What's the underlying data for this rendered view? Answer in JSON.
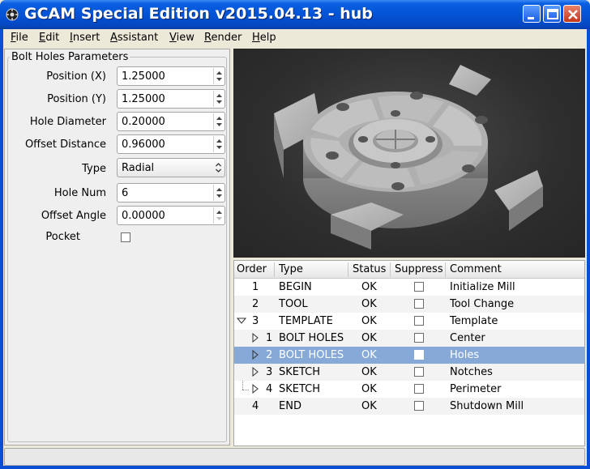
{
  "window": {
    "title": "GCAM Special Edition v2015.04.13 - hub",
    "title_color": "#0a4ed6",
    "controls": [
      "minimize-icon",
      "maximize-icon",
      "close-icon"
    ]
  },
  "menu": [
    {
      "label": "File",
      "accel": "F"
    },
    {
      "label": "Edit",
      "accel": "E"
    },
    {
      "label": "Insert",
      "accel": "I"
    },
    {
      "label": "Assistant",
      "accel": "A"
    },
    {
      "label": "View",
      "accel": "V"
    },
    {
      "label": "Render",
      "accel": "R"
    },
    {
      "label": "Help",
      "accel": "H"
    }
  ],
  "params": {
    "group_title": "Bolt Holes Parameters",
    "position_x": {
      "label": "Position (X)",
      "value": "1.25000"
    },
    "position_y": {
      "label": "Position (Y)",
      "value": "1.25000"
    },
    "hole_diameter": {
      "label": "Hole Diameter",
      "value": "0.20000"
    },
    "offset_distance": {
      "label": "Offset Distance",
      "value": "0.96000"
    },
    "type": {
      "label": "Type",
      "value": "Radial"
    },
    "hole_num": {
      "label": "Hole Num",
      "value": "6"
    },
    "offset_angle": {
      "label": "Offset Angle",
      "value": "0.00000"
    },
    "pocket": {
      "label": "Pocket",
      "checked": false
    }
  },
  "tree": {
    "columns": [
      "Order",
      "Type",
      "Status",
      "Suppress",
      "Comment"
    ],
    "selection_color": "#86a9d8",
    "rows": [
      {
        "order": "1",
        "type": "BEGIN",
        "status": "OK",
        "comment": "Initialize Mill"
      },
      {
        "order": "2",
        "type": "TOOL",
        "status": "OK",
        "comment": "Tool Change"
      },
      {
        "order": "3",
        "type": "TEMPLATE",
        "status": "OK",
        "comment": "Template"
      },
      {
        "order": "1",
        "type": "BOLT HOLES",
        "status": "OK",
        "comment": "Center"
      },
      {
        "order": "2",
        "type": "BOLT HOLES",
        "status": "OK",
        "comment": "Holes"
      },
      {
        "order": "3",
        "type": "SKETCH",
        "status": "OK",
        "comment": "Notches"
      },
      {
        "order": "4",
        "type": "SKETCH",
        "status": "OK",
        "comment": "Perimeter"
      },
      {
        "order": "4",
        "type": "END",
        "status": "OK",
        "comment": "Shutdown Mill"
      }
    ]
  }
}
